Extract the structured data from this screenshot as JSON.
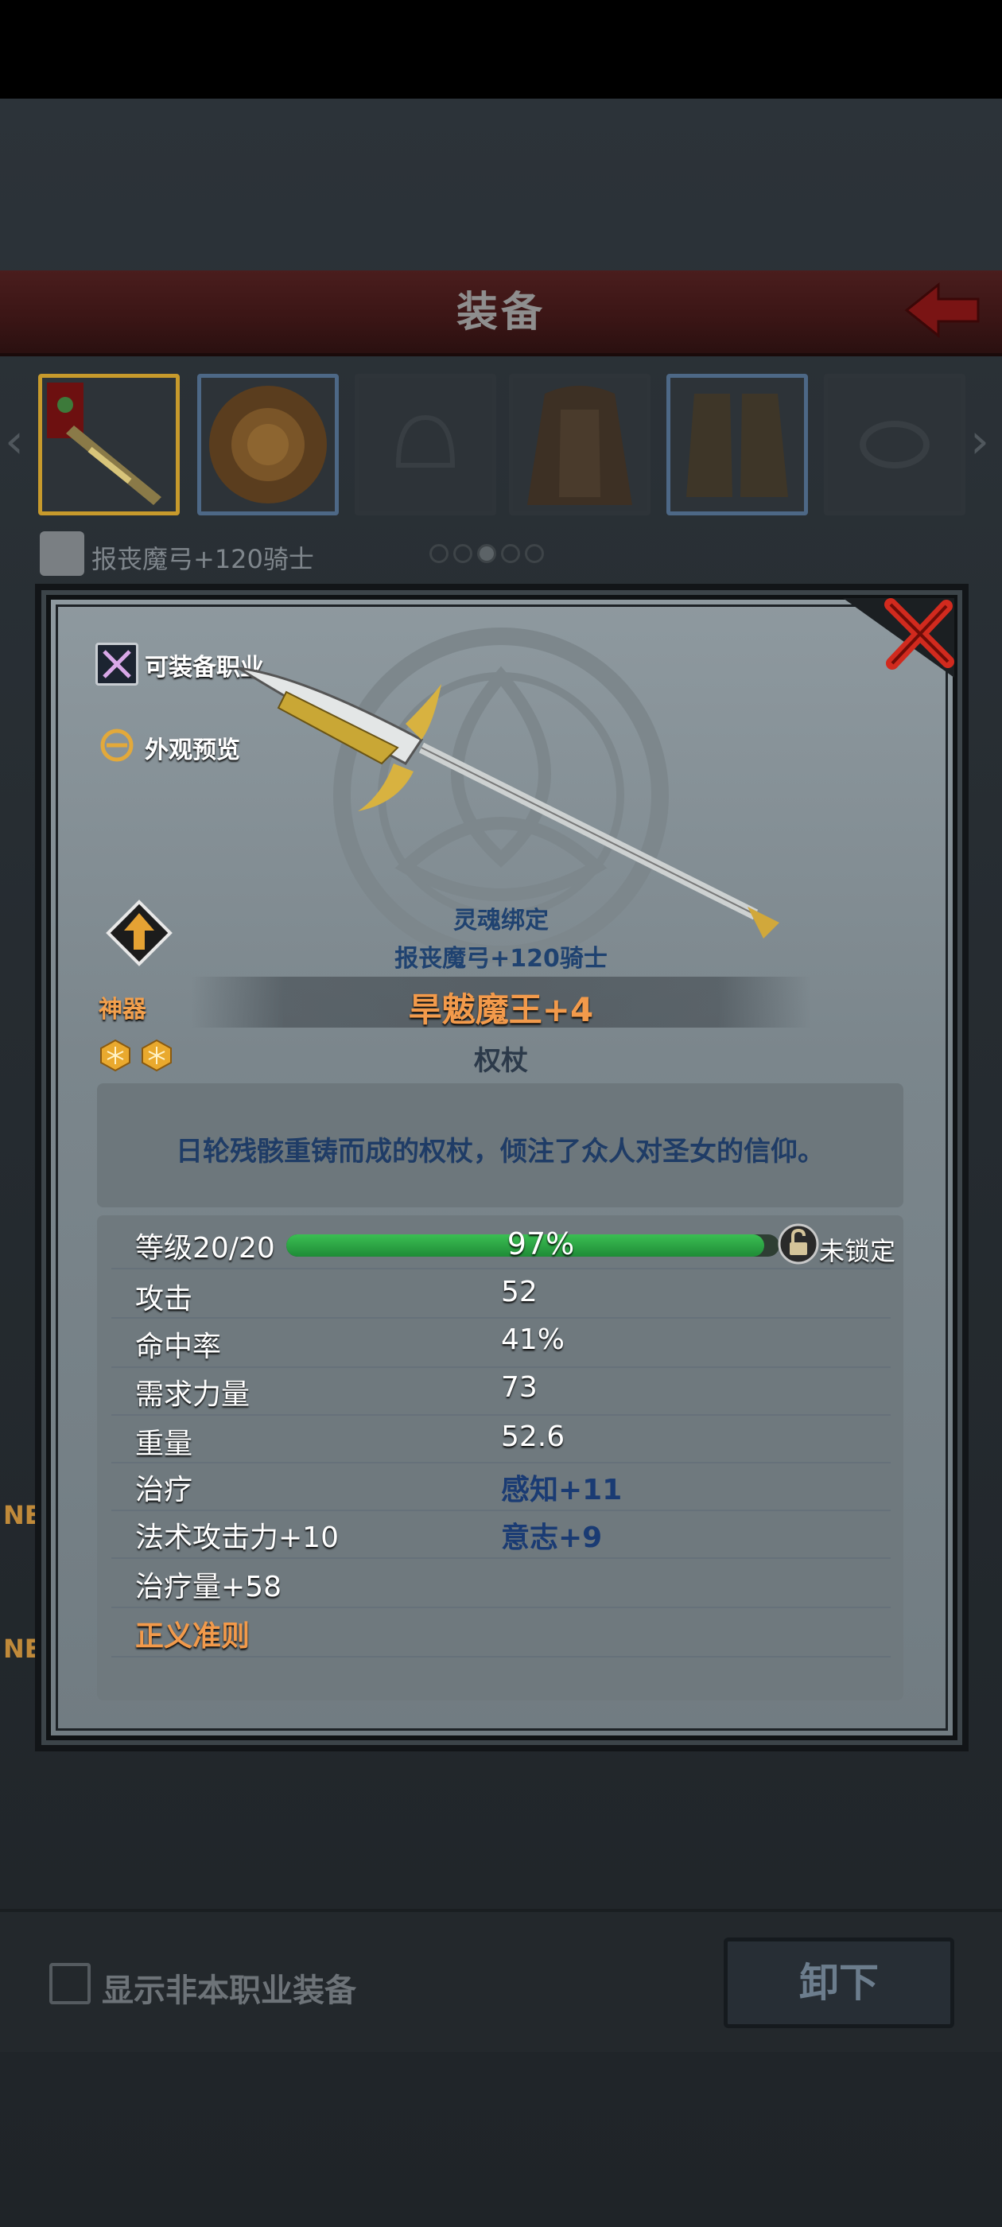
{
  "header": {
    "title": "装备"
  },
  "character": {
    "name": "报丧魔弓+120骑士"
  },
  "slots": [
    "weapon",
    "shield",
    "helmet",
    "armor",
    "boots",
    "ring"
  ],
  "pager": {
    "count": 5,
    "active": 2
  },
  "side_labels": [
    "NE",
    "NE"
  ],
  "modal": {
    "actions": {
      "equippable_classes": "可装备职业",
      "appearance_preview": "外观预览"
    },
    "rarity": "神器",
    "soulbound_label": "灵魂绑定",
    "soulbound_owner": "报丧魔弓+120骑士",
    "item_name": "旱魃魔王+4",
    "item_type": "权杖",
    "description": "日轮残骸重铸而成的权杖，倾注了众人对圣女的信仰。",
    "level": {
      "label": "等级20/20",
      "progress_pct": 97,
      "progress_text": "97%",
      "lock_status": "未锁定"
    },
    "stats": [
      {
        "label": "攻击",
        "value": "52"
      },
      {
        "label": "命中率",
        "value": "41%"
      },
      {
        "label": "需求力量",
        "value": "73"
      },
      {
        "label": "重量",
        "value": "52.6"
      },
      {
        "label": "治疗",
        "value": "感知+11"
      },
      {
        "label": "法术攻击力+10",
        "value": "意志+9"
      },
      {
        "label": "治疗量+58",
        "value": ""
      },
      {
        "label": "正义准则",
        "value": ""
      }
    ],
    "gem_count": 2
  },
  "footer": {
    "show_other_class_label": "显示非本职业装备",
    "unequip_label": "卸下"
  },
  "colors": {
    "accent_orange": "#f29a4b",
    "soulbound_blue": "#1f4270",
    "xp_green": "#2fa94a",
    "close_red": "#d12a1e"
  }
}
